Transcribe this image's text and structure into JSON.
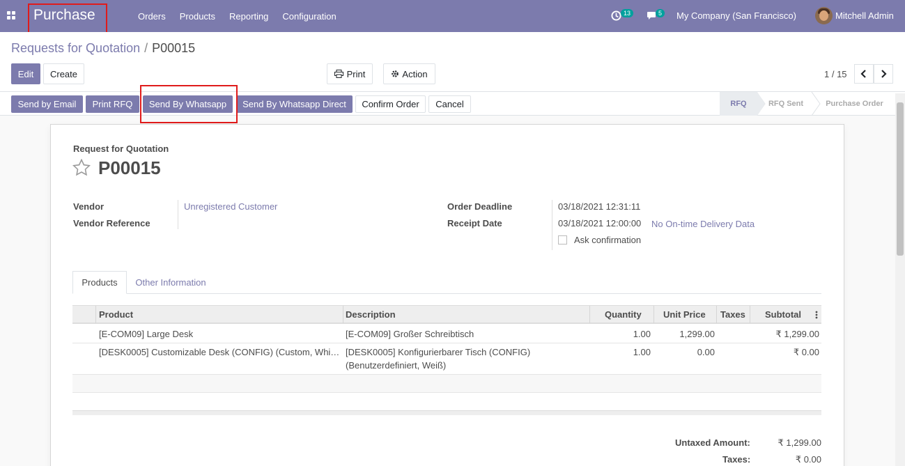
{
  "navbar": {
    "app_name": "Purchase",
    "menu": [
      "Orders",
      "Products",
      "Reporting",
      "Configuration"
    ],
    "activity_count": "13",
    "message_count": "5",
    "company": "My Company (San Francisco)",
    "user": "Mitchell Admin"
  },
  "breadcrumb": {
    "parent": "Requests for Quotation",
    "separator": "/",
    "current": "P00015"
  },
  "toolbar": {
    "edit": "Edit",
    "create": "Create",
    "print": "Print",
    "action": "Action"
  },
  "pager": {
    "value": "1 / 15"
  },
  "statusbar": {
    "buttons": [
      "Send by Email",
      "Print RFQ",
      "Send By Whatsapp",
      "Send By Whatsapp Direct",
      "Confirm Order",
      "Cancel"
    ],
    "stages": [
      "RFQ",
      "RFQ Sent",
      "Purchase Order"
    ],
    "active_stage": "RFQ"
  },
  "form": {
    "doc_type": "Request for Quotation",
    "name": "P00015",
    "vendor_label": "Vendor",
    "vendor_value": "Unregistered Customer",
    "vendor_ref_label": "Vendor Reference",
    "deadline_label": "Order Deadline",
    "deadline_value": "03/18/2021 12:31:11",
    "receipt_label": "Receipt Date",
    "receipt_value": "03/18/2021 12:00:00",
    "ontime_link": "No On-time Delivery Data",
    "ask_confirmation": "Ask confirmation"
  },
  "tabs": [
    "Products",
    "Other Information"
  ],
  "table": {
    "columns": [
      "Product",
      "Description",
      "Quantity",
      "Unit Price",
      "Taxes",
      "Subtotal"
    ],
    "rows": [
      {
        "product": "[E-COM09] Large Desk",
        "description": "[E-COM09] Großer Schreibtisch",
        "description2": "",
        "quantity": "1.00",
        "unit_price": "1,299.00",
        "taxes": "",
        "subtotal": "₹ 1,299.00"
      },
      {
        "product": "[DESK0005] Customizable Desk (CONFIG) (Custom, Whi…",
        "description": "[DESK0005] Konfigurierbarer Tisch (CONFIG)",
        "description2": "(Benutzerdefiniert, Weiß)",
        "quantity": "1.00",
        "unit_price": "0.00",
        "taxes": "",
        "subtotal": "₹ 0.00"
      }
    ]
  },
  "totals": {
    "untaxed_label": "Untaxed Amount:",
    "untaxed_value": "₹ 1,299.00",
    "taxes_label": "Taxes:",
    "taxes_value": "₹ 0.00"
  },
  "colors": {
    "brand": "#7c7bad",
    "highlight_box": "#e01b1b",
    "badge": "#00a09d"
  },
  "icons": [
    "apps-grid-icon",
    "activity-clock-icon",
    "messages-chat-icon",
    "print-icon",
    "gear-icon",
    "chevron-left-icon",
    "chevron-right-icon",
    "star-icon",
    "kebab-menu-icon"
  ]
}
